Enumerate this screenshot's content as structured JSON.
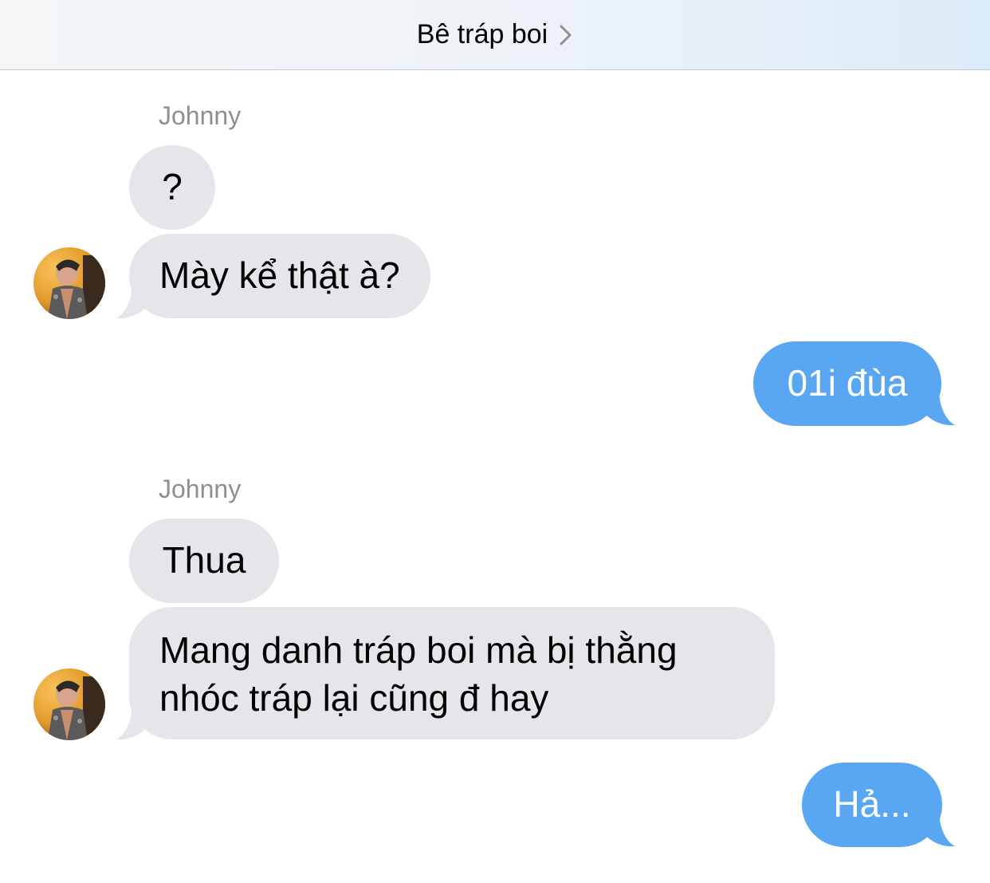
{
  "header": {
    "title": "Bê tráp boi"
  },
  "messages": [
    {
      "sender": "Johnny",
      "text": "?"
    },
    {
      "sender": "Johnny",
      "text": "Mày kể thật à?"
    },
    {
      "sender": "me",
      "text": "01i đùa"
    },
    {
      "sender": "Johnny",
      "text": "Thua"
    },
    {
      "sender": "Johnny",
      "lines": [
        "Mang danh tráp boi mà bị thằng",
        "nhóc tráp lại cũng đ hay"
      ]
    },
    {
      "sender": "me",
      "text": "Hả..."
    }
  ],
  "sender_labels": [
    "Johnny",
    "Johnny"
  ],
  "colors": {
    "incoming_bubble": "#e5e5ea",
    "outgoing_bubble": "#59a7f2",
    "sender_name": "#8e8e93"
  },
  "icons": {
    "header_chevron": "chevron-right-icon",
    "avatar": "contact-avatar"
  }
}
